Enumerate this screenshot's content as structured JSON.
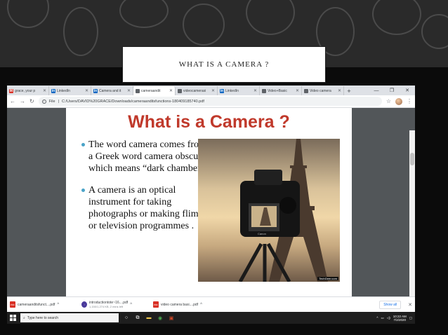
{
  "slide": {
    "title": "WHAT IS A CAMERA ?"
  },
  "browser": {
    "tabs": [
      {
        "label": "grace, your p",
        "icon": "gmail-icon",
        "color": "#d93025",
        "active": false
      },
      {
        "label": "LinkedIn",
        "icon": "linkedin-icon",
        "color": "#0a66c2",
        "active": false
      },
      {
        "label": "Camera and it",
        "icon": "linkedin-icon",
        "color": "#0a66c2",
        "active": false
      },
      {
        "label": "cameraandit",
        "icon": "globe-icon",
        "color": "#5f6368",
        "active": true
      },
      {
        "label": "videocamerasi",
        "icon": "globe-icon",
        "color": "#5f6368",
        "active": false
      },
      {
        "label": "LinkedIn",
        "icon": "linkedin-icon",
        "color": "#0a66c2",
        "active": false
      },
      {
        "label": "Video+Basic",
        "icon": "doc-icon",
        "color": "#5f6368",
        "active": false
      },
      {
        "label": "Video camera",
        "icon": "doc-icon",
        "color": "#5f6368",
        "active": false
      }
    ],
    "address": {
      "scheme": "File",
      "url": "C:/Users/DAVID%20GRACE/Downloads/cameraanditsfunctions-180409185740.pdf"
    }
  },
  "pdf": {
    "heading": "What is a Camera ?",
    "bullets": [
      "The word camera comes from a Greek word camera obscura which means “dark chamber”",
      "A camera is an optical instrument for taking photographs or making flims or television programmes ."
    ],
    "photo": {
      "watermark": "TechGeer.com",
      "camera_brand": "Canon"
    }
  },
  "downloads": {
    "items": [
      {
        "name": "cameraanditsfunct....pdf",
        "sub": ""
      },
      {
        "name": "introductiontote~16....pdf",
        "sub": "1,150/1,274 KB, 2 mins left"
      },
      {
        "name": "video camera basi....pdf",
        "sub": ""
      }
    ],
    "show_all": "Show all"
  },
  "taskbar": {
    "search_placeholder": "Type here to search",
    "time": "10:22 AM",
    "date": "7/2/2020"
  },
  "colors": {
    "heading_red": "#c0392b",
    "bullet_blue": "#4aa3c8"
  }
}
